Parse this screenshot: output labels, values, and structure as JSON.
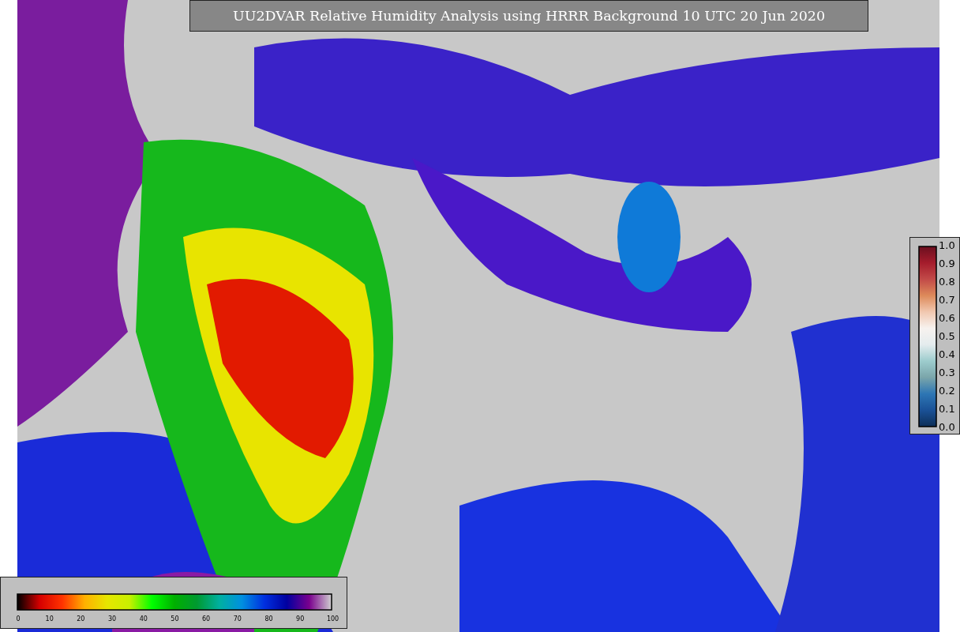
{
  "title": "UU2DVAR Relative Humidity Analysis using HRRR Background 10 UTC 20 Jun 2020",
  "ratio_colorbar": {
    "ticks": [
      "1.0",
      "0.9",
      "0.8",
      "0.7",
      "0.6",
      "0.5",
      "0.4",
      "0.3",
      "0.2",
      "0.1",
      "0.0"
    ]
  },
  "humidity_colorbar": {
    "ticks": [
      "0",
      "10",
      "20",
      "30",
      "40",
      "50",
      "60",
      "70",
      "80",
      "90",
      "100"
    ]
  }
}
